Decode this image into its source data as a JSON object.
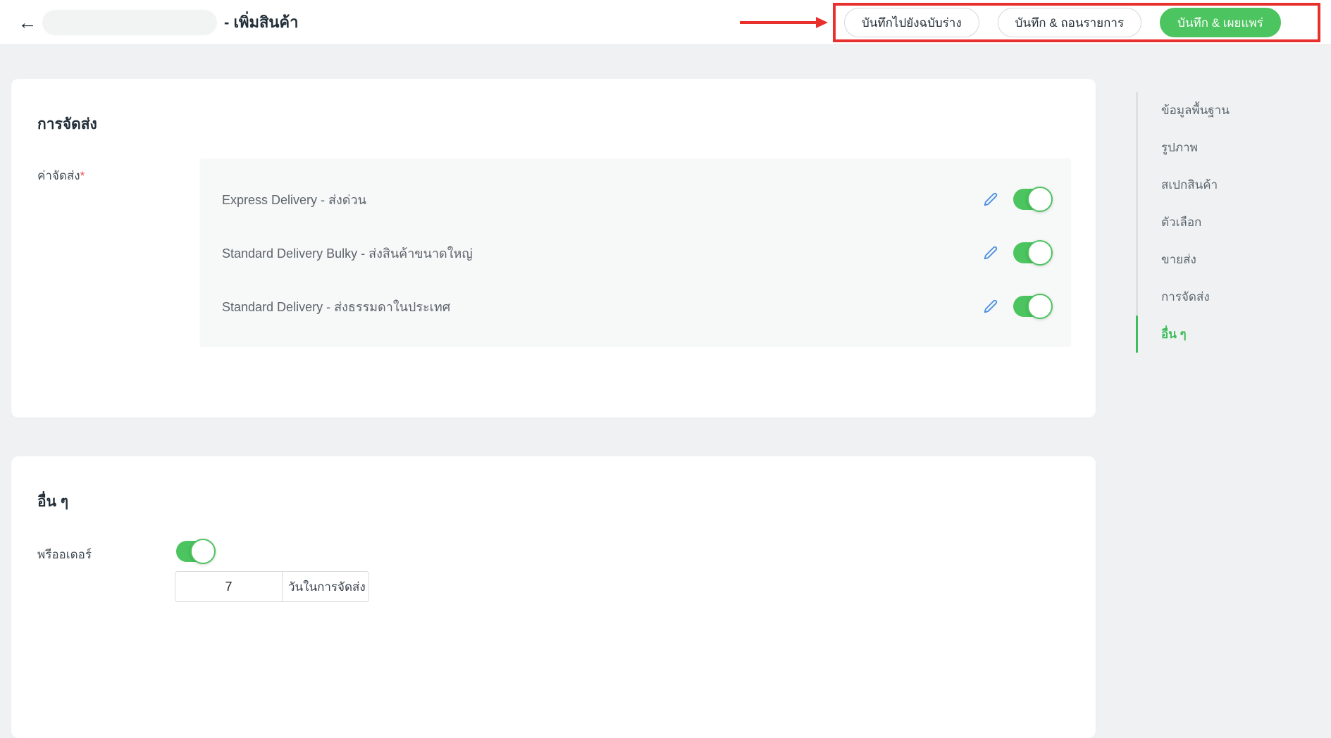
{
  "header": {
    "title_suffix": "- เพิ่มสินค้า",
    "back_icon": "arrow-left",
    "buttons": {
      "draft": "บันทึกไปยังฉบับร่าง",
      "delist": "บันทึก & ถอนรายการ",
      "publish": "บันทึก & เผยแพร่"
    },
    "annotation": {
      "shape": "red-box-with-arrow",
      "color": "#e8302d"
    }
  },
  "shipping_card": {
    "title": "การจัดส่ง",
    "field_label": "ค่าจัดส่ง",
    "required_mark": "*",
    "options": [
      {
        "label": "Express Delivery - ส่งด่วน",
        "enabled": true
      },
      {
        "label": "Standard Delivery Bulky - ส่งสินค้าขนาดใหญ่",
        "enabled": true
      },
      {
        "label": "Standard Delivery - ส่งธรรมดาในประเทศ",
        "enabled": true
      }
    ],
    "row_icons": [
      "pencil-edit",
      "toggle-switch"
    ]
  },
  "others_card": {
    "title": "อื่น ๆ",
    "preorder_label": "พรีออเดอร์",
    "preorder_enabled": true,
    "days_value": "7",
    "days_unit": "วันในการจัดส่ง"
  },
  "sidebar": {
    "items": [
      {
        "label": "ข้อมูลพื้นฐาน",
        "active": false
      },
      {
        "label": "รูปภาพ",
        "active": false
      },
      {
        "label": "สเปกสินค้า",
        "active": false
      },
      {
        "label": "ตัวเลือก",
        "active": false
      },
      {
        "label": "ขายส่ง",
        "active": false
      },
      {
        "label": "การจัดส่ง",
        "active": false
      },
      {
        "label": "อื่น ๆ",
        "active": true
      }
    ]
  },
  "colors": {
    "green_primary": "#4cc45f",
    "green_active": "#3fbd5c",
    "red_annotation": "#e8302d",
    "edit_blue": "#4a8fdf",
    "page_background": "#f0f1f2"
  }
}
